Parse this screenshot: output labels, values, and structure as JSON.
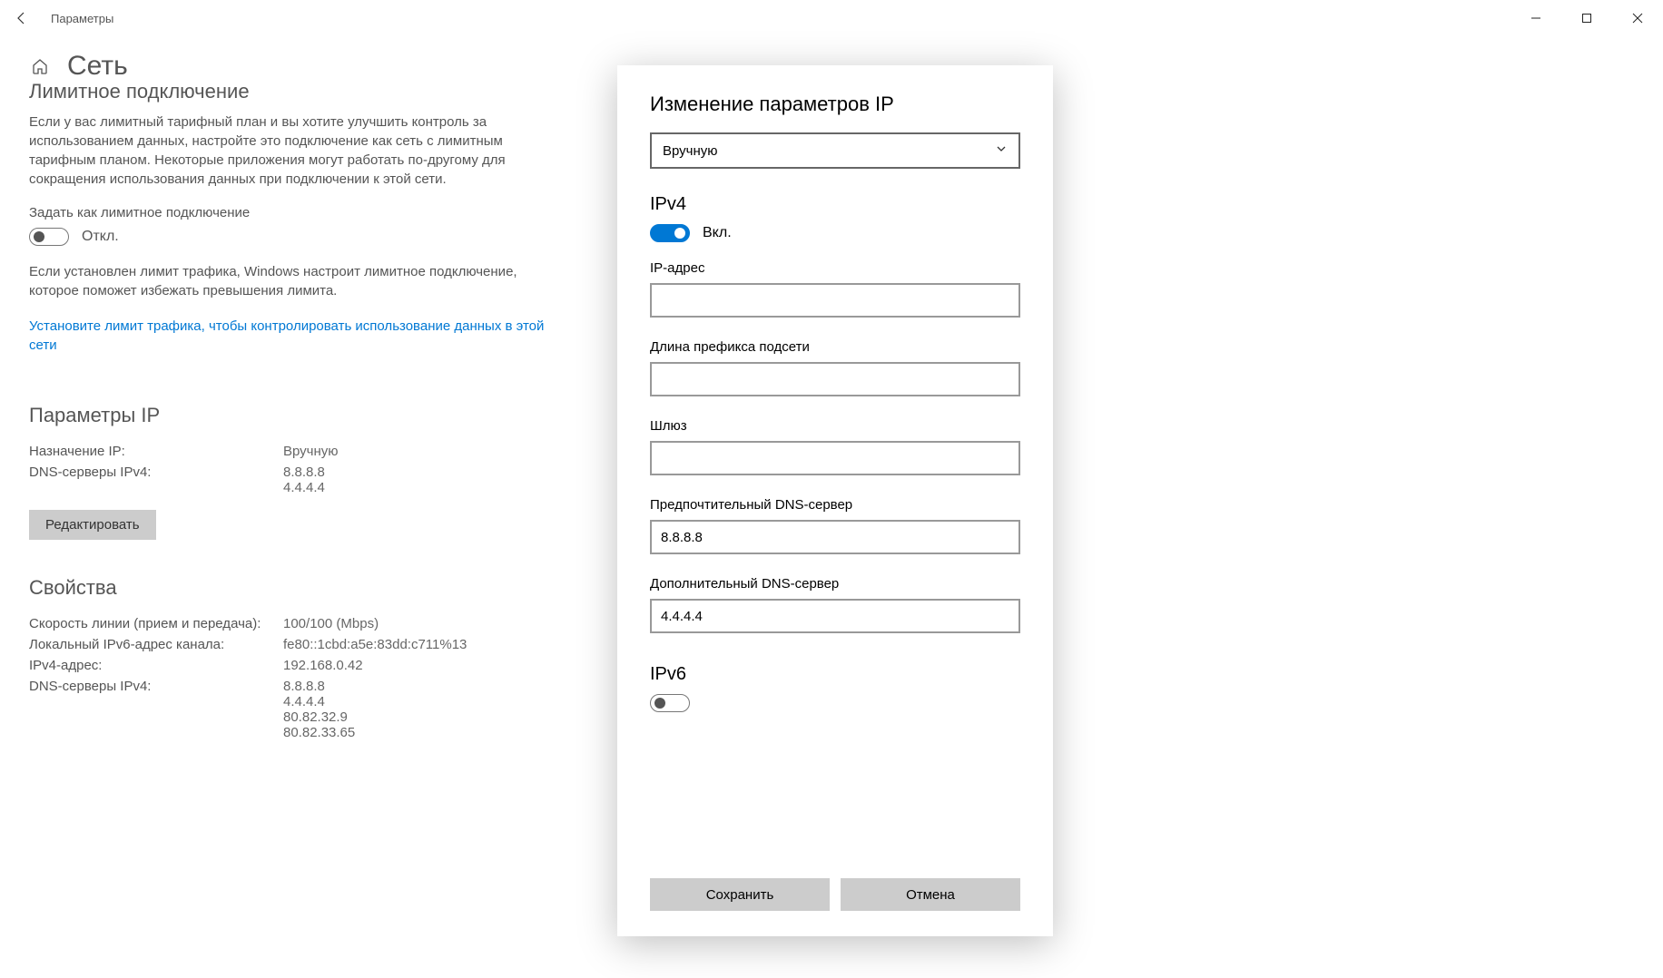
{
  "window": {
    "title": "Параметры"
  },
  "page": {
    "header": "Сеть",
    "metered": {
      "heading": "Лимитное подключение",
      "desc": "Если у вас лимитный тарифный план и вы хотите улучшить контроль за использованием данных, настройте это подключение как сеть с лимитным тарифным планом. Некоторые приложения могут работать по-другому для сокращения использования данных при подключении к этой сети.",
      "toggle_label": "Задать как лимитное подключение",
      "toggle_state": "Откл.",
      "desc2": "Если установлен лимит трафика, Windows настроит лимитное подключение, которое поможет избежать превышения лимита.",
      "link": "Установите лимит трафика, чтобы контролировать использование данных в этой сети"
    },
    "ip_params": {
      "heading": "Параметры IP",
      "rows": [
        {
          "k": "Назначение IP:",
          "v": "Вручную"
        },
        {
          "k": "DNS-серверы IPv4:",
          "v": "8.8.8.8\n4.4.4.4"
        }
      ],
      "edit_btn": "Редактировать"
    },
    "props": {
      "heading": "Свойства",
      "rows": [
        {
          "k": "Скорость линии (прием и передача):",
          "v": "100/100 (Mbps)"
        },
        {
          "k": "Локальный IPv6-адрес канала:",
          "v": "fe80::1cbd:a5e:83dd:c711%13"
        },
        {
          "k": "IPv4-адрес:",
          "v": "192.168.0.42"
        },
        {
          "k": "DNS-серверы IPv4:",
          "v": "8.8.8.8\n4.4.4.4\n80.82.32.9\n80.82.33.65"
        }
      ]
    }
  },
  "modal": {
    "title": "Изменение параметров IP",
    "mode": "Вручную",
    "ipv4": {
      "heading": "IPv4",
      "state": "Вкл.",
      "fields": {
        "ip_label": "IP-адрес",
        "ip_val": "",
        "prefix_label": "Длина префикса подсети",
        "prefix_val": "",
        "gw_label": "Шлюз",
        "gw_val": "",
        "dns1_label": "Предпочтительный DNS-сервер",
        "dns1_val": "8.8.8.8",
        "dns2_label": "Дополнительный DNS-сервер",
        "dns2_val": "4.4.4.4"
      }
    },
    "ipv6": {
      "heading": "IPv6"
    },
    "save": "Сохранить",
    "cancel": "Отмена"
  }
}
